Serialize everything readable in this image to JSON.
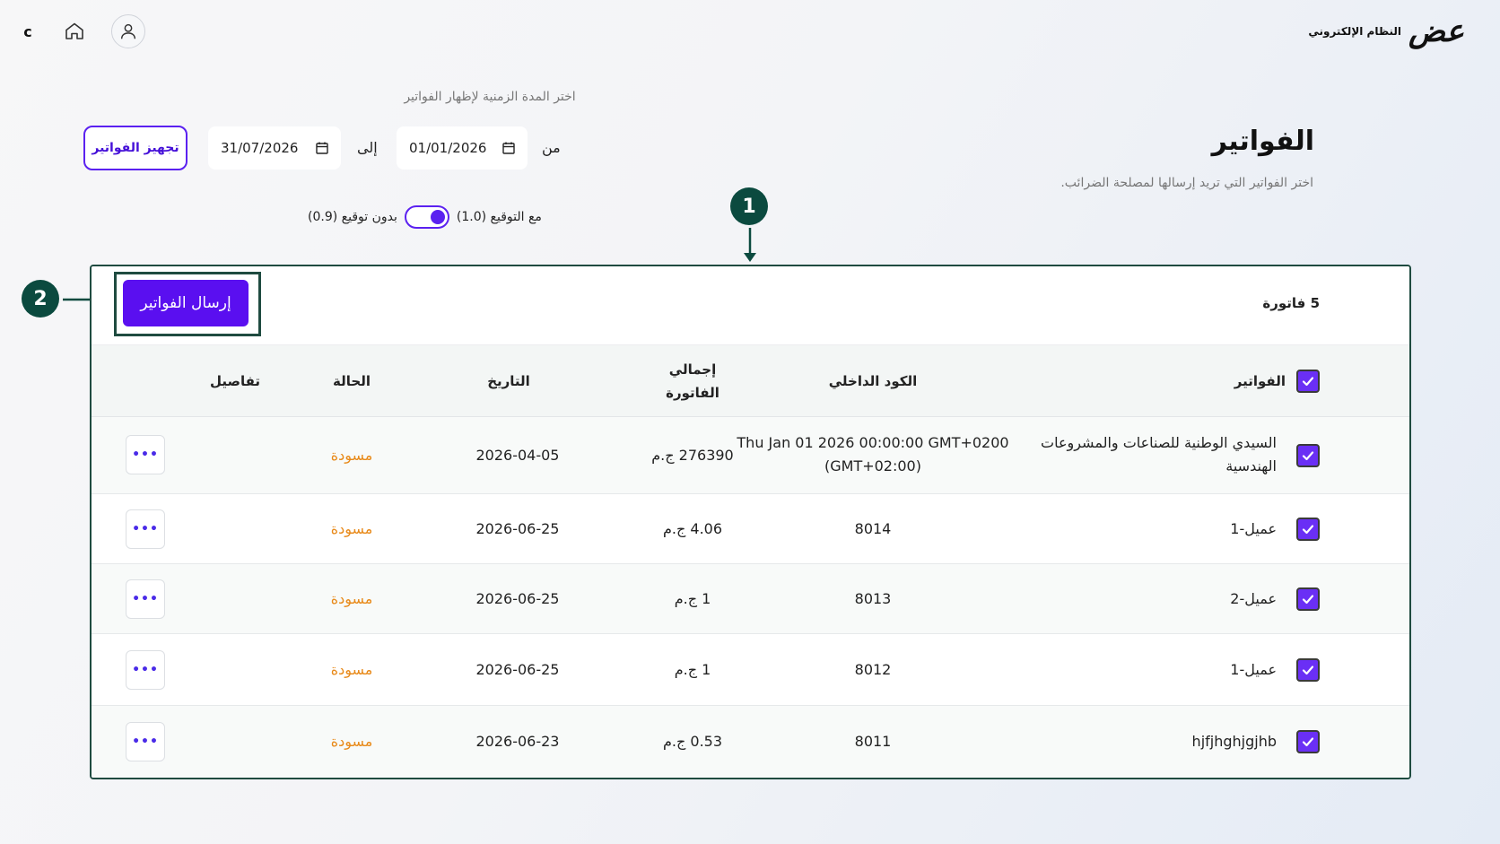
{
  "topbar": {
    "letter": "c",
    "brand_logo": "عض",
    "brand_name": "النظام الإلكتروني"
  },
  "page": {
    "title": "الفواتير",
    "subtitle": "اختر الفواتير التي تريد إرسالها لمصلحة الضرائب.",
    "range_label": "اختر المدة الزمنية لإظهار الفواتير"
  },
  "filters": {
    "from_label": "من",
    "from_value": "01/01/2026",
    "to_label": "إلى",
    "to_value": "31/07/2026",
    "prepare_button": "تجهيز الفواتير",
    "signed_label": "مع التوقيع (1.0)",
    "unsigned_label": "بدون توقيع (0.9)"
  },
  "annotations": {
    "marker_1": "1",
    "marker_2": "2"
  },
  "card": {
    "count": "5 فاتورة",
    "send_button": "إرسال الفواتير"
  },
  "table": {
    "headers": {
      "invoices": "الفواتير",
      "internal_code": "الكود الداخلي",
      "total_line1": "إجمالي",
      "total_line2": "الفاتورة",
      "date": "التاريخ",
      "status": "الحالة",
      "details": "تفاصيل"
    },
    "rows": [
      {
        "name_line1": "السيدي الوطنية للصناعات والمشروعات",
        "name_line2": "الهندسية",
        "code_line1": "Thu Jan 01 2026 00:00:00 GMT+0200",
        "code_line2": "(GMT+02:00)",
        "total": "276390 ج.م",
        "date": "2026-04-05",
        "status": "مسودة",
        "more": "•••"
      },
      {
        "name_line1": "عميل-1",
        "name_line2": "",
        "code_line1": "8014",
        "code_line2": "",
        "total": "4.06 ج.م",
        "date": "2026-06-25",
        "status": "مسودة",
        "more": "•••"
      },
      {
        "name_line1": "عميل-2",
        "name_line2": "",
        "code_line1": "8013",
        "code_line2": "",
        "total": "1 ج.م",
        "date": "2026-06-25",
        "status": "مسودة",
        "more": "•••"
      },
      {
        "name_line1": "عميل-1",
        "name_line2": "",
        "code_line1": "8012",
        "code_line2": "",
        "total": "1 ج.م",
        "date": "2026-06-25",
        "status": "مسودة",
        "more": "•••"
      },
      {
        "name_line1": "hjfjhghjgjhb",
        "name_line2": "",
        "code_line1": "8011",
        "code_line2": "",
        "total": "0.53 ج.م",
        "date": "2026-06-23",
        "status": "مسودة",
        "more": "•••"
      }
    ]
  },
  "colors": {
    "accent": "#5a0ff0",
    "status_draft": "#e88a1a",
    "annotation": "#0b4a3f"
  },
  "icons": [
    "home-icon",
    "user-icon",
    "calendar-icon",
    "check-icon",
    "more-icon"
  ]
}
